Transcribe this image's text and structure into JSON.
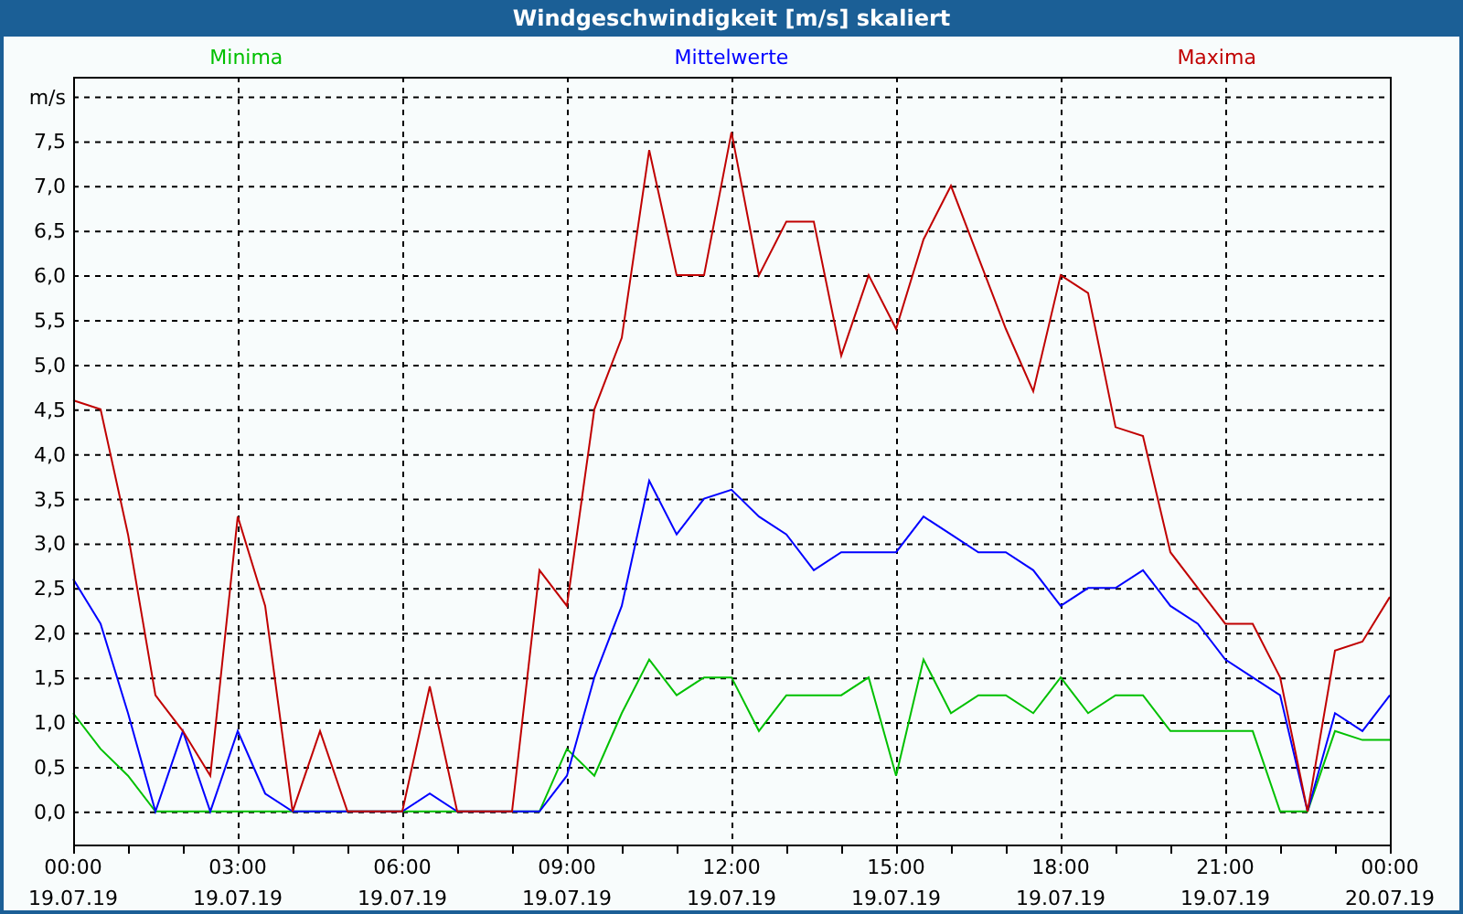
{
  "window": {
    "title": "Windgeschwindigkeit [m/s] skaliert"
  },
  "chart_data": {
    "type": "line",
    "ylabel": "m/s",
    "categories": [
      "00:00\n19.07.19",
      null,
      null,
      null,
      null,
      null,
      "03:00\n19.07.19",
      null,
      null,
      null,
      null,
      null,
      "06:00\n19.07.19",
      null,
      null,
      null,
      null,
      null,
      "09:00\n19.07.19",
      null,
      null,
      null,
      null,
      null,
      "12:00\n19.07.19",
      null,
      null,
      null,
      null,
      null,
      "15:00\n19.07.19",
      null,
      null,
      null,
      null,
      null,
      "18:00\n19.07.19",
      null,
      null,
      null,
      null,
      null,
      "21:00\n19.07.19",
      null,
      null,
      null,
      null,
      null,
      "00:00\n20.07.19"
    ],
    "series": [
      {
        "name": "Minima",
        "color": "#00c000",
        "values": [
          1.1,
          0.7,
          0.4,
          0,
          0,
          0,
          0,
          0,
          0,
          0,
          0,
          0,
          0,
          0,
          0,
          0,
          0,
          0,
          0.7,
          0.4,
          1.1,
          1.7,
          1.3,
          1.5,
          1.5,
          0.9,
          1.3,
          1.3,
          1.3,
          1.5,
          0.4,
          1.7,
          1.1,
          1.3,
          1.3,
          1.1,
          1.5,
          1.1,
          1.3,
          1.3,
          0.9,
          0.9,
          0.9,
          0.9,
          0,
          0,
          0.9,
          0.8,
          0.8
        ]
      },
      {
        "name": "Mittelwerte",
        "color": "#0000ff",
        "values": [
          2.6,
          2.1,
          1.1,
          0,
          0.9,
          0,
          0.9,
          0.2,
          0,
          0,
          0,
          0,
          0,
          0.2,
          0,
          0,
          0,
          0,
          0.4,
          1.5,
          2.3,
          3.7,
          3.1,
          3.5,
          3.6,
          3.3,
          3.1,
          2.7,
          2.9,
          2.9,
          2.9,
          3.3,
          3.1,
          2.9,
          2.9,
          2.7,
          2.3,
          2.5,
          2.5,
          2.7,
          2.3,
          2.1,
          1.7,
          1.5,
          1.3,
          0,
          1.1,
          0.9,
          1.3
        ]
      },
      {
        "name": "Maxima",
        "color": "#c00000",
        "values": [
          4.6,
          4.5,
          3.1,
          1.3,
          0.9,
          0.4,
          3.3,
          2.3,
          0,
          0.9,
          0,
          0,
          0,
          1.4,
          0,
          0,
          0,
          2.7,
          2.3,
          4.5,
          5.3,
          7.4,
          6.0,
          6.0,
          7.6,
          6.0,
          6.6,
          6.6,
          5.1,
          6.0,
          5.4,
          6.4,
          7.0,
          6.2,
          5.4,
          4.7,
          6.0,
          5.8,
          4.3,
          4.2,
          2.9,
          2.5,
          2.1,
          2.1,
          1.5,
          0,
          1.8,
          1.9,
          2.4
        ]
      }
    ],
    "ylim": [
      -0.37,
      8.22
    ],
    "grid": true,
    "yticks": [
      {
        "value": 0,
        "label": "0,0"
      },
      {
        "value": 0.5,
        "label": "0,5"
      },
      {
        "value": 1,
        "label": "1,0"
      },
      {
        "value": 1.5,
        "label": "1,5"
      },
      {
        "value": 2,
        "label": "2,0"
      },
      {
        "value": 2.5,
        "label": "2,5"
      },
      {
        "value": 3,
        "label": "3,0"
      },
      {
        "value": 3.5,
        "label": "3,5"
      },
      {
        "value": 4,
        "label": "4,0"
      },
      {
        "value": 4.5,
        "label": "4,5"
      },
      {
        "value": 5,
        "label": "5,0"
      },
      {
        "value": 5.5,
        "label": "5,5"
      },
      {
        "value": 6,
        "label": "6,0"
      },
      {
        "value": 6.5,
        "label": "6,5"
      },
      {
        "value": 7,
        "label": "7,0"
      },
      {
        "value": 7.5,
        "label": "7,5"
      }
    ]
  }
}
